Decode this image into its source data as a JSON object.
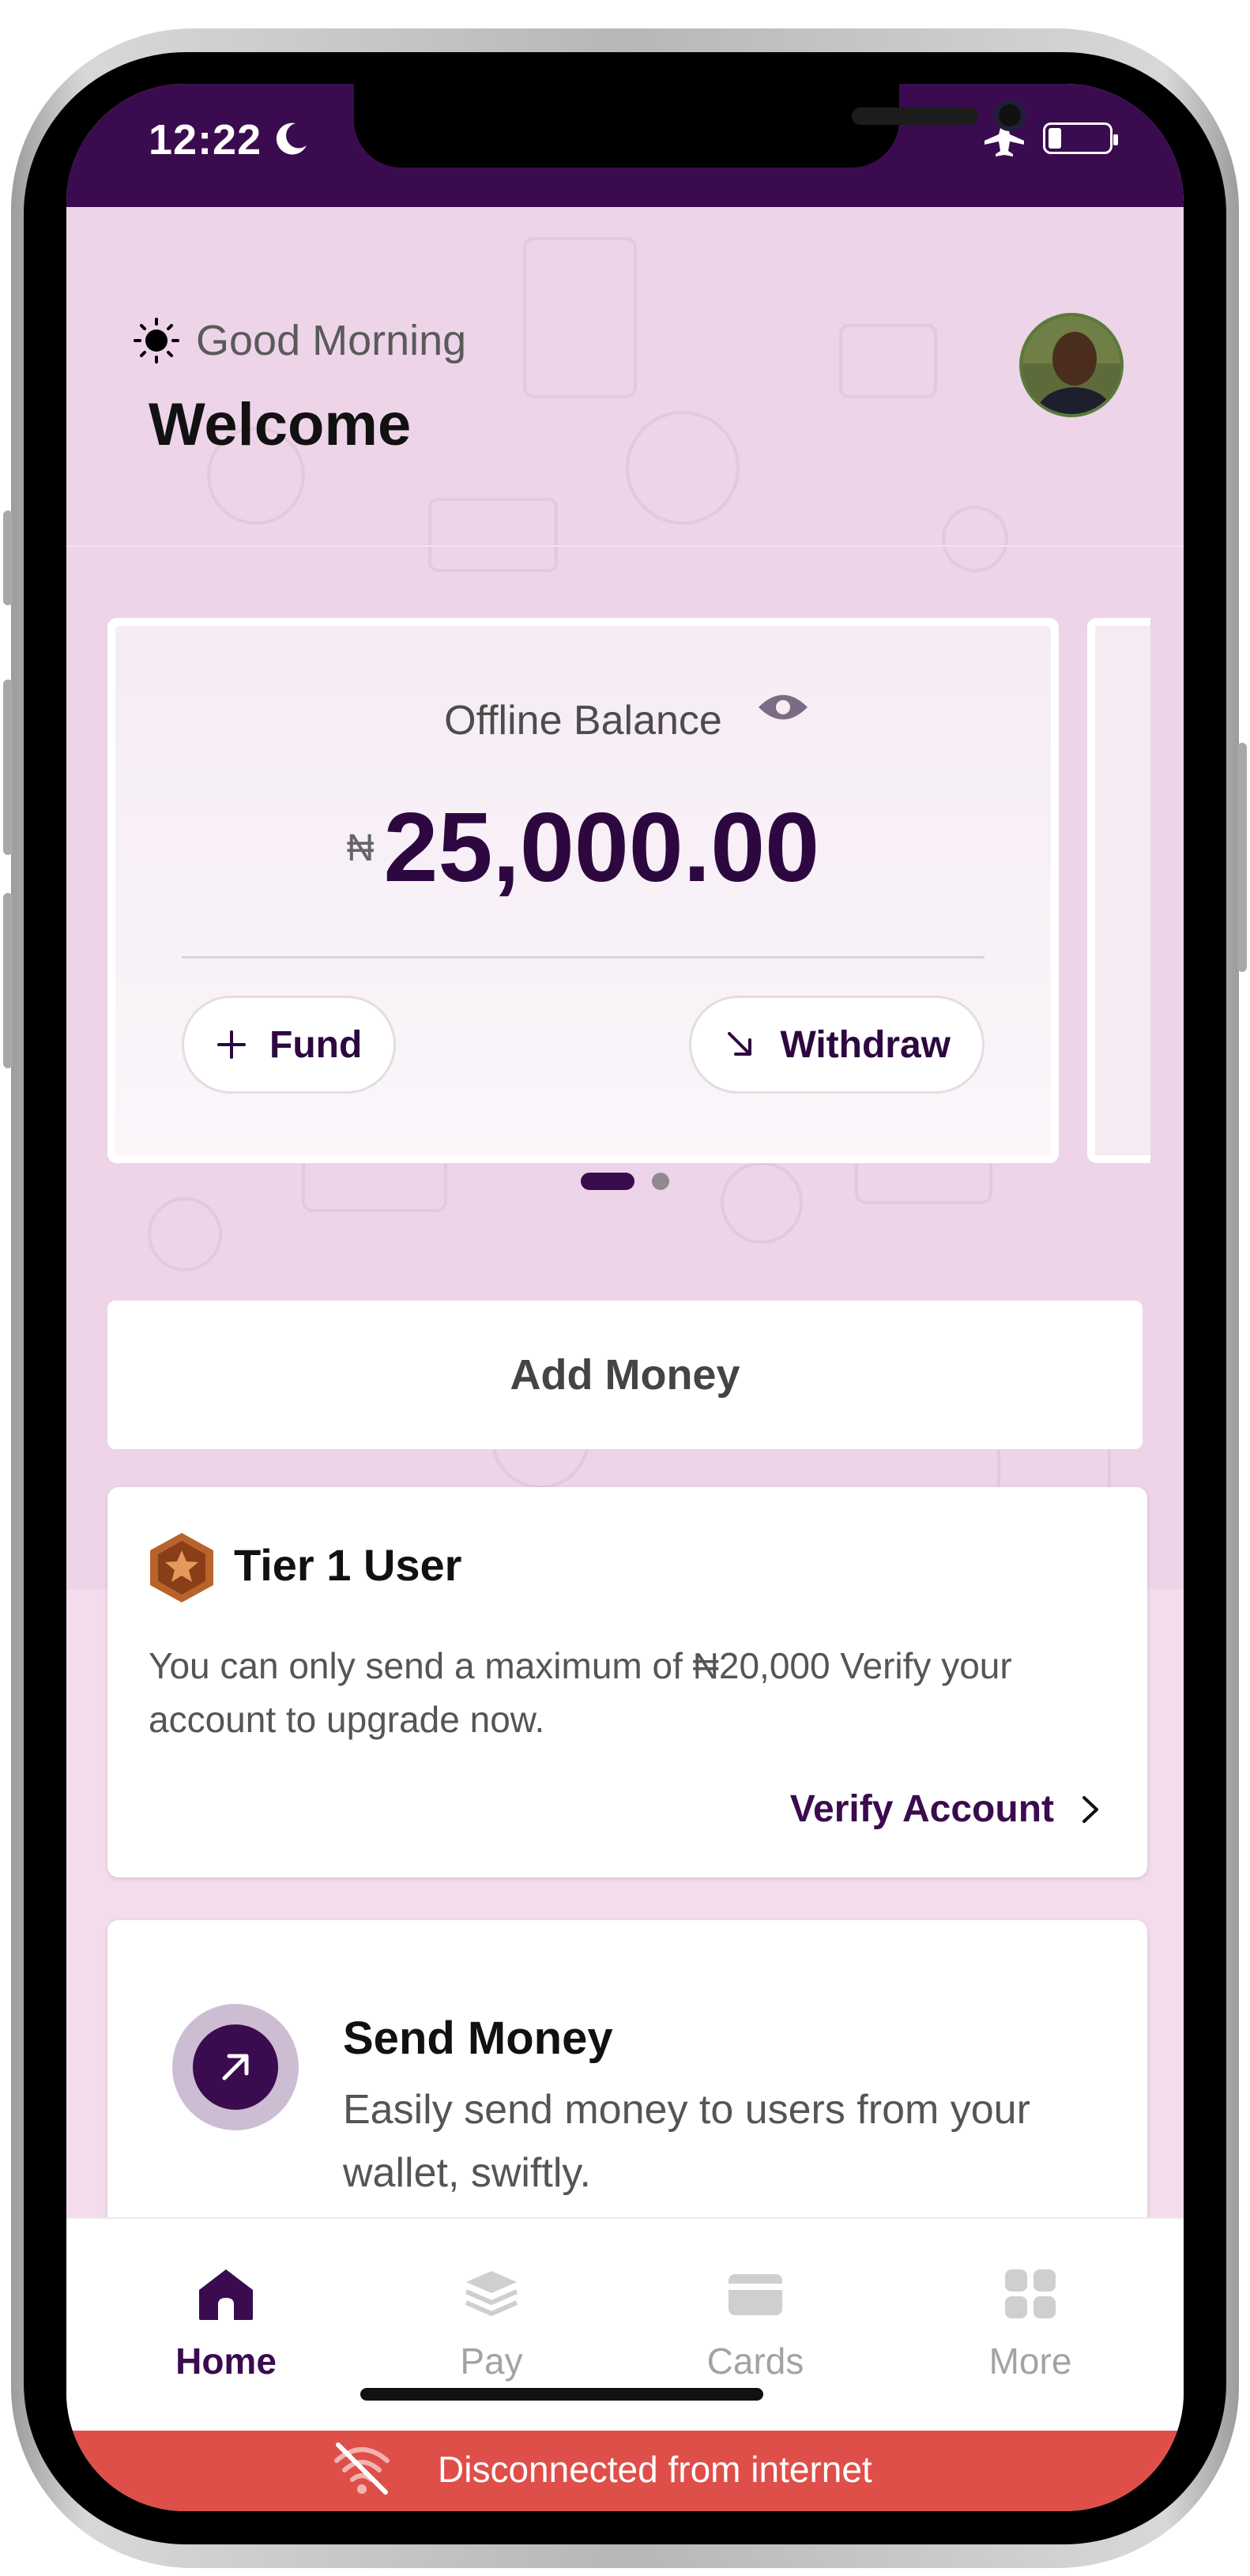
{
  "status_bar": {
    "time": "12:22",
    "icons": [
      "moon-icon",
      "airplane-icon",
      "battery-icon"
    ]
  },
  "header": {
    "greeting": "Good Morning",
    "title": "Welcome"
  },
  "balance_card": {
    "label": "Offline Balance",
    "currency_symbol": "₦",
    "amount": "25,000.00",
    "fund_label": "Fund",
    "withdraw_label": "Withdraw"
  },
  "carousel": {
    "pages": 2,
    "active_page": 1
  },
  "add_money_label": "Add Money",
  "tier": {
    "title": "Tier 1 User",
    "description": "You can only send a maximum of ₦20,000 Verify your account to upgrade now.",
    "action_label": "Verify Account"
  },
  "send_money": {
    "title": "Send Money",
    "description": "Easily send money to users from your wallet, swiftly."
  },
  "tabs": [
    {
      "label": "Home",
      "icon": "home-icon",
      "active": true
    },
    {
      "label": "Pay",
      "icon": "layers-icon",
      "active": false
    },
    {
      "label": "Cards",
      "icon": "card-icon",
      "active": false
    },
    {
      "label": "More",
      "icon": "grid-icon",
      "active": false
    }
  ],
  "offline_banner": {
    "text": "Disconnected from internet"
  },
  "colors": {
    "brand": "#3b0b4f",
    "hero_bg": "#edd4e8",
    "banner_red": "#df4f4a"
  }
}
